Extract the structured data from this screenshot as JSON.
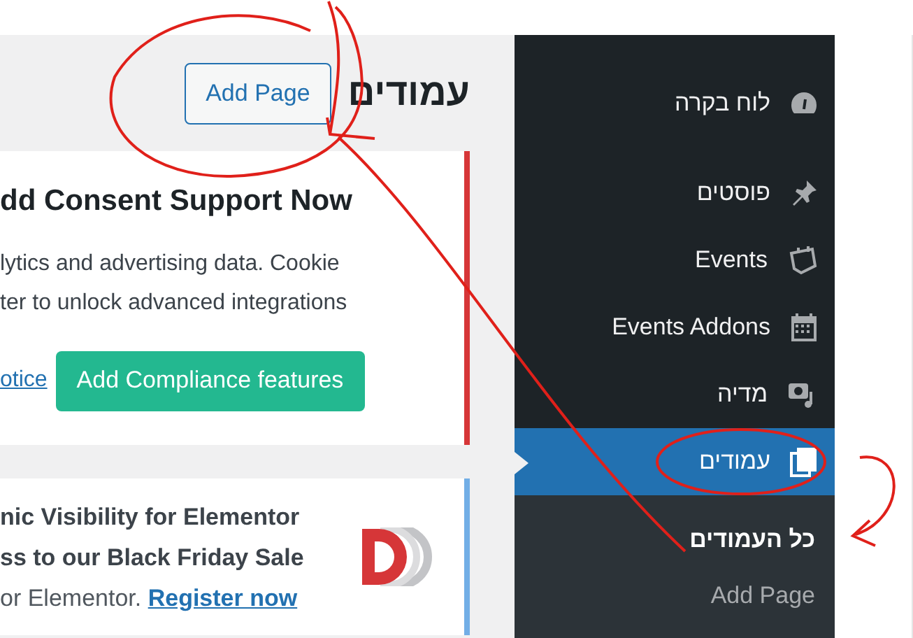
{
  "page": {
    "title": "עמודים",
    "add_button": "Add Page"
  },
  "notices": [
    {
      "title": "dd Consent Support Now",
      "lines": [
        "lytics and advertising data. Cookie",
        "ter to unlock advanced integrations"
      ],
      "link": "otice",
      "button": "Add Compliance features",
      "color": "#d63638"
    },
    {
      "title_lines": [
        "nic Visibility for Elementor",
        "ss to our Black Friday Sale"
      ],
      "text": "or Elementor.",
      "link": "Register now",
      "color": "#72aee6"
    }
  ],
  "sidebar": {
    "items": [
      {
        "label": "לוח בקרה",
        "selected": false
      },
      {
        "label": "פוסטים",
        "selected": false
      },
      {
        "label": "Events",
        "selected": false
      },
      {
        "label": "Events Addons",
        "selected": false
      },
      {
        "label": "מדיה",
        "selected": false
      },
      {
        "label": "עמודים",
        "selected": true,
        "children": [
          {
            "label": "כל העמודים",
            "selected": true
          },
          {
            "label": "Add Page",
            "selected": false
          }
        ]
      }
    ]
  }
}
